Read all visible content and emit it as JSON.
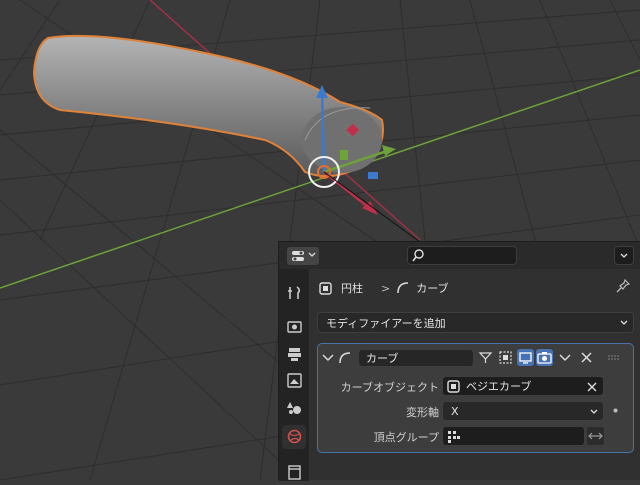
{
  "breadcrumb": {
    "object_name": "円柱",
    "separator": ">",
    "modifier_name": "カーブ"
  },
  "add_modifier": {
    "label": "モディファイアーを追加"
  },
  "modifier": {
    "name": "カーブ",
    "curve_object_label": "カーブオブジェクト",
    "curve_object_value": "ベジエカーブ",
    "deform_axis_label": "変形軸",
    "deform_axis_value": "X",
    "vertex_group_label": "頂点グループ",
    "vertex_group_value": ""
  },
  "icons": [
    "editor-type-icon",
    "search-icon",
    "pin-icon",
    "tool-icon",
    "render-icon",
    "output-icon",
    "view-layer-icon",
    "scene-icon",
    "world-icon",
    "collection-icon",
    "modifier-collapse-icon",
    "curve-modifier-icon",
    "edit-mode-icon",
    "cage-icon",
    "realtime-icon",
    "render-toggle-icon",
    "dropdown-icon",
    "close-icon",
    "drag-handle-icon",
    "object-icon",
    "swap-icon",
    "vertex-group-icon"
  ],
  "colors": {
    "accent_blue": "#4a72a8",
    "selection_orange": "#e0823a",
    "x_axis_red": "#c0304a",
    "y_axis_green": "#6ea33a",
    "z_axis_blue": "#3a7ad0"
  }
}
